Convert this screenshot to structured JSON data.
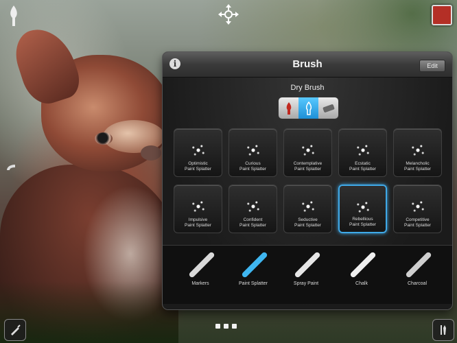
{
  "panel": {
    "title": "Brush",
    "edit_label": "Edit",
    "subtitle": "Dry Brush",
    "brushes": [
      {
        "line1": "Optimistic",
        "line2": "Paint Splatter",
        "selected": false
      },
      {
        "line1": "Curious",
        "line2": "Paint Splatter",
        "selected": false
      },
      {
        "line1": "Contemplative",
        "line2": "Paint Splatter",
        "selected": false
      },
      {
        "line1": "Ecstatic",
        "line2": "Paint Splatter",
        "selected": false
      },
      {
        "line1": "Melancholic",
        "line2": "Paint Splatter",
        "selected": false
      },
      {
        "line1": "Impulsive",
        "line2": "Paint Splatter",
        "selected": false
      },
      {
        "line1": "Confident",
        "line2": "Paint Splatter",
        "selected": false
      },
      {
        "line1": "Seductive",
        "line2": "Paint Splatter",
        "selected": false
      },
      {
        "line1": "Rebellious",
        "line2": "Paint Splatter",
        "selected": true
      },
      {
        "line1": "Competitive",
        "line2": "Paint Splatter",
        "selected": false
      }
    ],
    "tools": [
      {
        "label": "Markers",
        "color": "#d9d9d9"
      },
      {
        "label": "Paint Splatter",
        "color": "#3fb6f0"
      },
      {
        "label": "Spray Paint",
        "color": "#e6e6e6"
      },
      {
        "label": "Chalk",
        "color": "#efefef"
      },
      {
        "label": "Charcoal",
        "color": "#cfcfcf"
      }
    ]
  },
  "colors": {
    "current_color": "#b42f26",
    "accent": "#3fa9e8"
  },
  "icons": {
    "top_left": "brush-icon",
    "top_center": "move-icon",
    "side": "handle-icon",
    "bottom_left": "brush-tool-icon",
    "bottom_right": "tools-icon"
  }
}
